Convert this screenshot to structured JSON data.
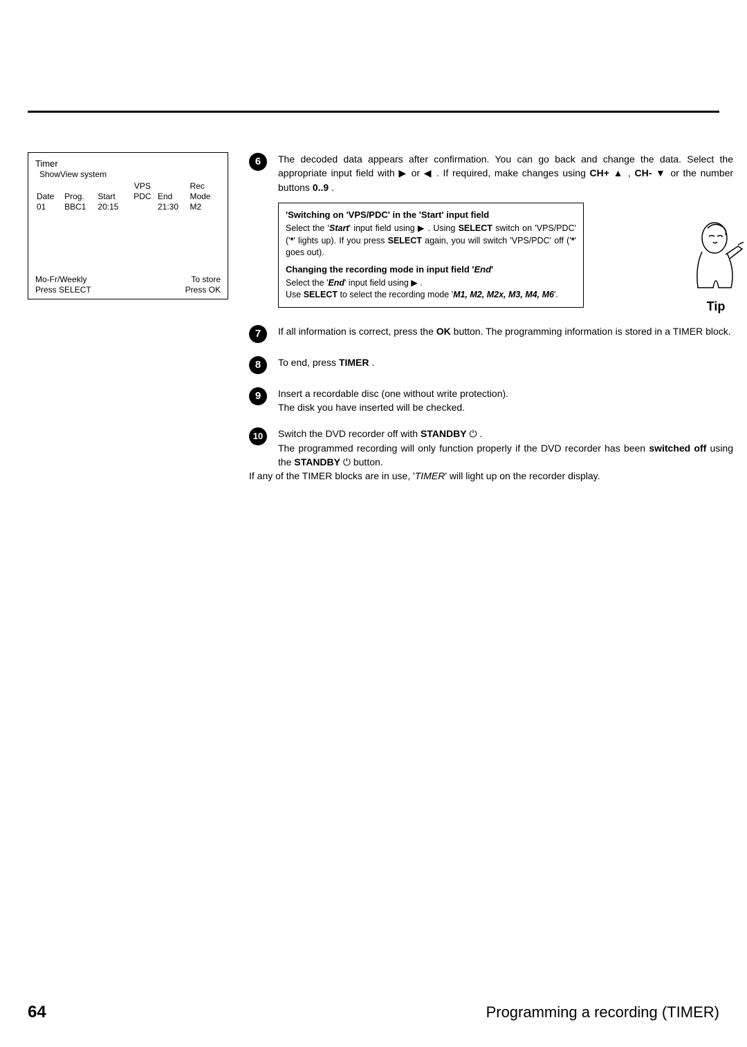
{
  "timer_box": {
    "title": "Timer",
    "subtitle": "ShowView system",
    "columns": [
      "Date",
      "Prog.",
      "Start",
      "VPS PDC",
      "End",
      "Rec Mode"
    ],
    "row": {
      "date": "01",
      "prog": "BBC1",
      "start": "20:15",
      "vps": "",
      "end": "21:30",
      "mode": "M2"
    },
    "foot_left_1": "Mo-Fr/Weekly",
    "foot_left_2": "Press SELECT",
    "foot_right_1": "To store",
    "foot_right_2": "Press OK"
  },
  "steps": {
    "s6": {
      "num": "6",
      "text_a": "The decoded data appears after confirmation. You can go back and change the data. Select the appropriate input field with ",
      "arrow_r": "▶",
      "text_b": " or ",
      "arrow_l": "◀",
      "text_c": " . If required, make changes using ",
      "chp": "CH+",
      "arrow_u": "▲",
      "sep1": " , ",
      "chm": "CH-",
      "arrow_d": "▼",
      "text_d": " or the number buttons ",
      "numbtn": "0..9",
      "text_e": " ."
    },
    "tip": {
      "hd1": "'Switching on 'VPS/PDC' in the 'Start' input field",
      "line1_a": "Select the '",
      "line1_b": "Start",
      "line1_c": "' input field using ",
      "arrow_r": "▶",
      "line1_d": " . Using ",
      "select": "SELECT",
      "line1_e": " switch on 'VPS/PDC' ('",
      "star": "*",
      "line1_f": "' lights up). If you press ",
      "line1_g": " again, you will switch 'VPS/PDC' off ('",
      "line1_h": "' goes out).",
      "hd2": "Changing the recording mode in input field 'End'",
      "line2_a": "Select the '",
      "line2_b": "End",
      "line2_c": "' input field using ",
      "line2_d": " .",
      "line3_a": "Use ",
      "line3_b": " to select the recording mode '",
      "modes": "M1, M2, M2x, M3, M4, M6",
      "line3_c": "'."
    },
    "tip_label": "Tip",
    "s7": {
      "num": "7",
      "text_a": "If all information is correct, press the ",
      "ok": "OK",
      "text_b": " button. The programming information is stored in a TIMER block."
    },
    "s8": {
      "num": "8",
      "text_a": "To end, press ",
      "timer": "TIMER",
      "text_b": " ."
    },
    "s9": {
      "num": "9",
      "text_a": "Insert a recordable disc (one without write protection).",
      "text_b": "The disk you have inserted will be checked."
    },
    "s10": {
      "num": "10",
      "text_a": "Switch the DVD recorder off with ",
      "standby": "STANDBY",
      "power": "⏻",
      "text_b": " .",
      "text_c": "The programmed recording will only function properly if the DVD recorder has been ",
      "switched_off": "switched off",
      "text_d": " using the ",
      "text_e": " button."
    }
  },
  "footer_note_a": "If any of the TIMER blocks are in use, '",
  "footer_note_b": "TIMER",
  "footer_note_c": "' will light up on the recorder display.",
  "page_num": "64",
  "page_title": "Programming a recording (TIMER)"
}
